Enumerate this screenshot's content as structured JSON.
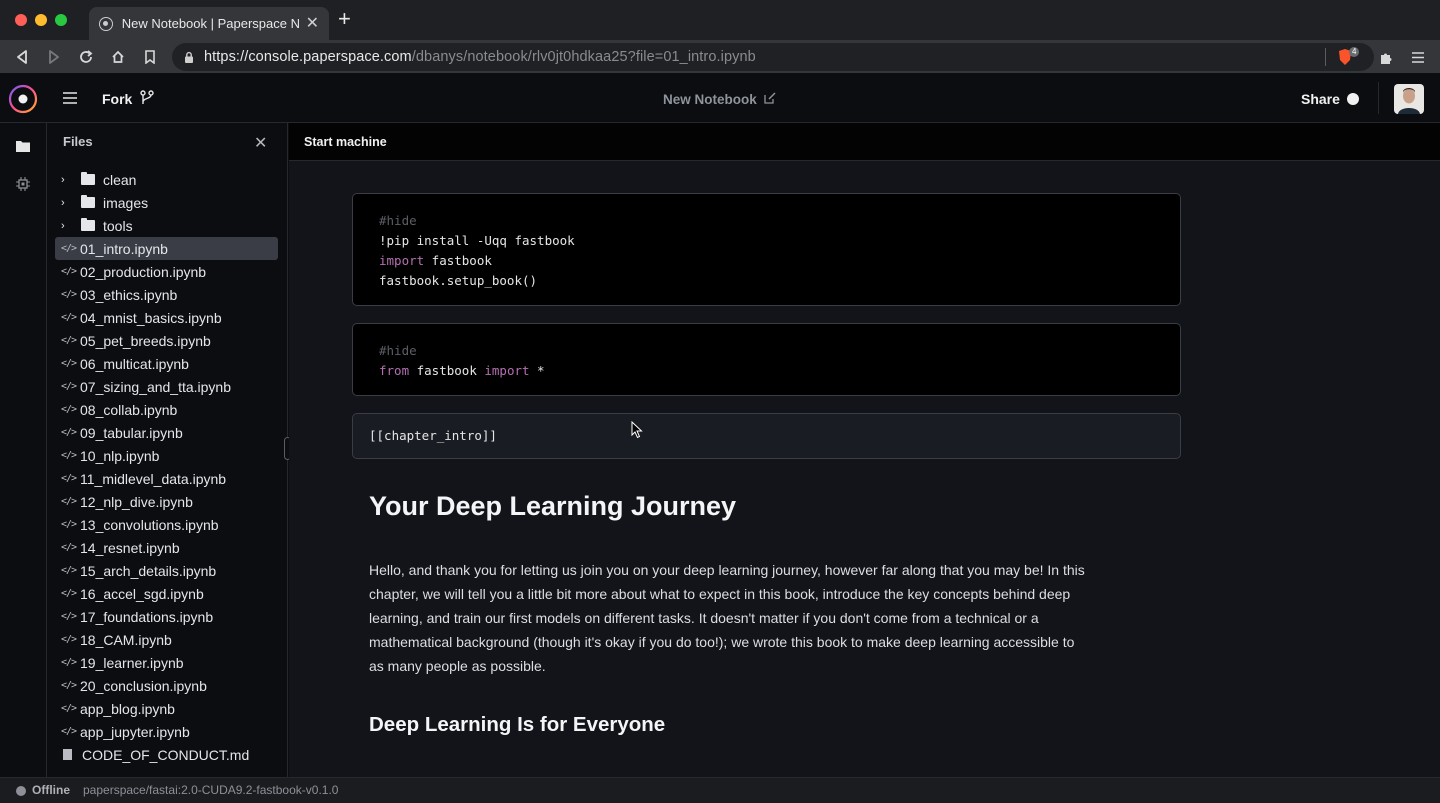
{
  "browser": {
    "tab_title": "New Notebook | Paperspace Notebooks",
    "url_domain": "https://console.paperspace.com",
    "url_path": "/dbanys/notebook/rlv0jt0hdkaa25?file=01_intro.ipynb",
    "shield_count": "4",
    "traffic_colors": [
      "#fe5f57",
      "#febc2e",
      "#28c840"
    ]
  },
  "header": {
    "fork_label": "Fork",
    "notebook_title": "New Notebook",
    "share_label": "Share"
  },
  "files": {
    "title": "Files",
    "folders": [
      "clean",
      "images",
      "tools"
    ],
    "notebooks": [
      "01_intro.ipynb",
      "02_production.ipynb",
      "03_ethics.ipynb",
      "04_mnist_basics.ipynb",
      "05_pet_breeds.ipynb",
      "06_multicat.ipynb",
      "07_sizing_and_tta.ipynb",
      "08_collab.ipynb",
      "09_tabular.ipynb",
      "10_nlp.ipynb",
      "11_midlevel_data.ipynb",
      "12_nlp_dive.ipynb",
      "13_convolutions.ipynb",
      "14_resnet.ipynb",
      "15_arch_details.ipynb",
      "16_accel_sgd.ipynb",
      "17_foundations.ipynb",
      "18_CAM.ipynb",
      "19_learner.ipynb",
      "20_conclusion.ipynb",
      "app_blog.ipynb",
      "app_jupyter.ipynb"
    ],
    "selected": "01_intro.ipynb",
    "docs": [
      "CODE_OF_CONDUCT.md"
    ]
  },
  "notebook": {
    "start_machine_label": "Start machine",
    "cell1": {
      "comment": "#hide",
      "line1": "!pip install -Uqq fastbook",
      "line2_kw": "import",
      "line2_rest": " fastbook",
      "line3": "fastbook.setup_book()"
    },
    "cell2": {
      "comment": "#hide",
      "kw_from": "from",
      "mid": " fastbook ",
      "kw_import": "import",
      "tail": " *"
    },
    "cell3": {
      "text": "[[chapter_intro]]"
    },
    "heading": "Your Deep Learning Journey",
    "paragraph": "Hello, and thank you for letting us join you on your deep learning journey, however far along that you may be! In this chapter, we will tell you a little bit more about what to expect in this book, introduce the key concepts behind deep learning, and train our first models on different tasks. It doesn't matter if you don't come from a technical or a mathematical background (though it's okay if you do too!); we wrote this book to make deep learning accessible to as many people as possible.",
    "subheading": "Deep Learning Is for Everyone"
  },
  "status": {
    "state": "Offline",
    "container": "paperspace/fastai:2.0-CUDA9.2-fastbook-v0.1.0"
  }
}
